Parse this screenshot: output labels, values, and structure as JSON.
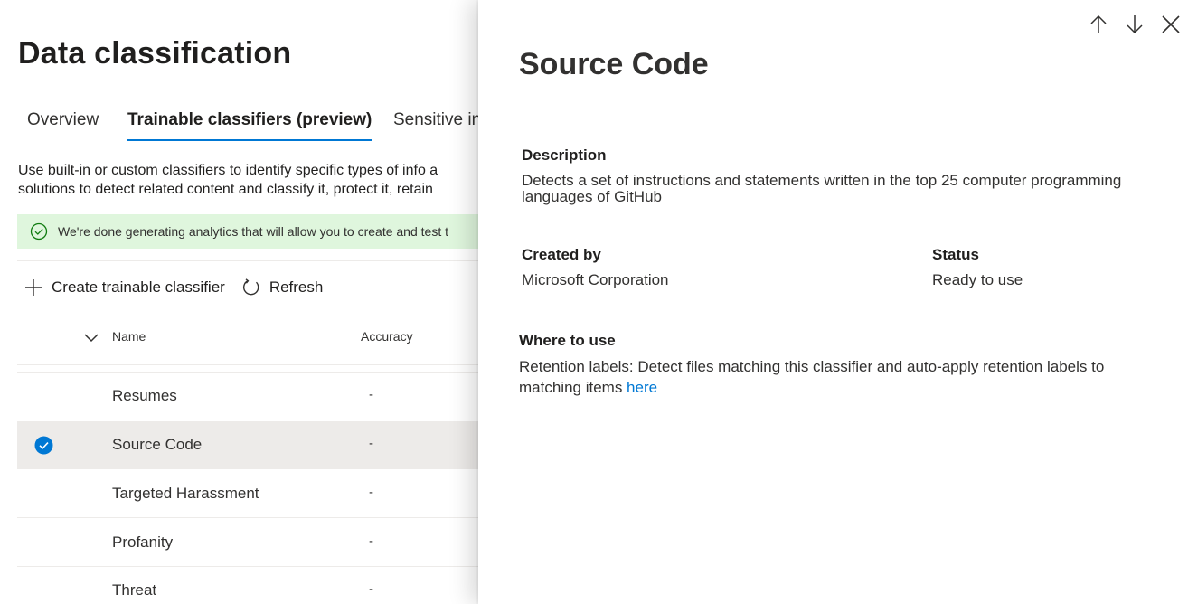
{
  "page": {
    "title": "Data classification"
  },
  "tabs": [
    {
      "label": "Overview",
      "active": false
    },
    {
      "label": "Trainable classifiers (preview)",
      "active": true
    },
    {
      "label": "Sensitive in",
      "active": false
    }
  ],
  "intro": {
    "line1": "Use built-in or custom classifiers to identify specific types of info a",
    "line2": "solutions to detect related content and classify it, protect it, retain"
  },
  "banner": {
    "text": "We're done generating analytics that will allow you to create and test t",
    "icon": "check-circle-icon",
    "color": "#dff6dd"
  },
  "commands": {
    "create_label": "Create trainable classifier",
    "refresh_label": "Refresh"
  },
  "table": {
    "headers": {
      "name": "Name",
      "accuracy": "Accuracy"
    },
    "rows": [
      {
        "name": "Resumes",
        "accuracy": "-",
        "selected": false
      },
      {
        "name": "Source Code",
        "accuracy": "-",
        "selected": true
      },
      {
        "name": "Targeted Harassment",
        "accuracy": "-",
        "selected": false
      },
      {
        "name": "Profanity",
        "accuracy": "-",
        "selected": false
      },
      {
        "name": "Threat",
        "accuracy": "-",
        "selected": false
      }
    ]
  },
  "panel": {
    "title": "Source Code",
    "description_label": "Description",
    "description_line1": "Detects a set of instructions and statements written in the top 25 computer programming",
    "description_line2": "languages of GitHub",
    "created_by_label": "Created by",
    "created_by_value": "Microsoft Corporation",
    "status_label": "Status",
    "status_value": "Ready to use",
    "where_label": "Where to use",
    "where_text_line1": "Retention labels: Detect files matching this classifier and auto-apply retention labels to",
    "where_text_line2": "matching items ",
    "where_link": "here"
  },
  "colors": {
    "accent": "#0078d4",
    "selected_row": "#edebe9"
  }
}
